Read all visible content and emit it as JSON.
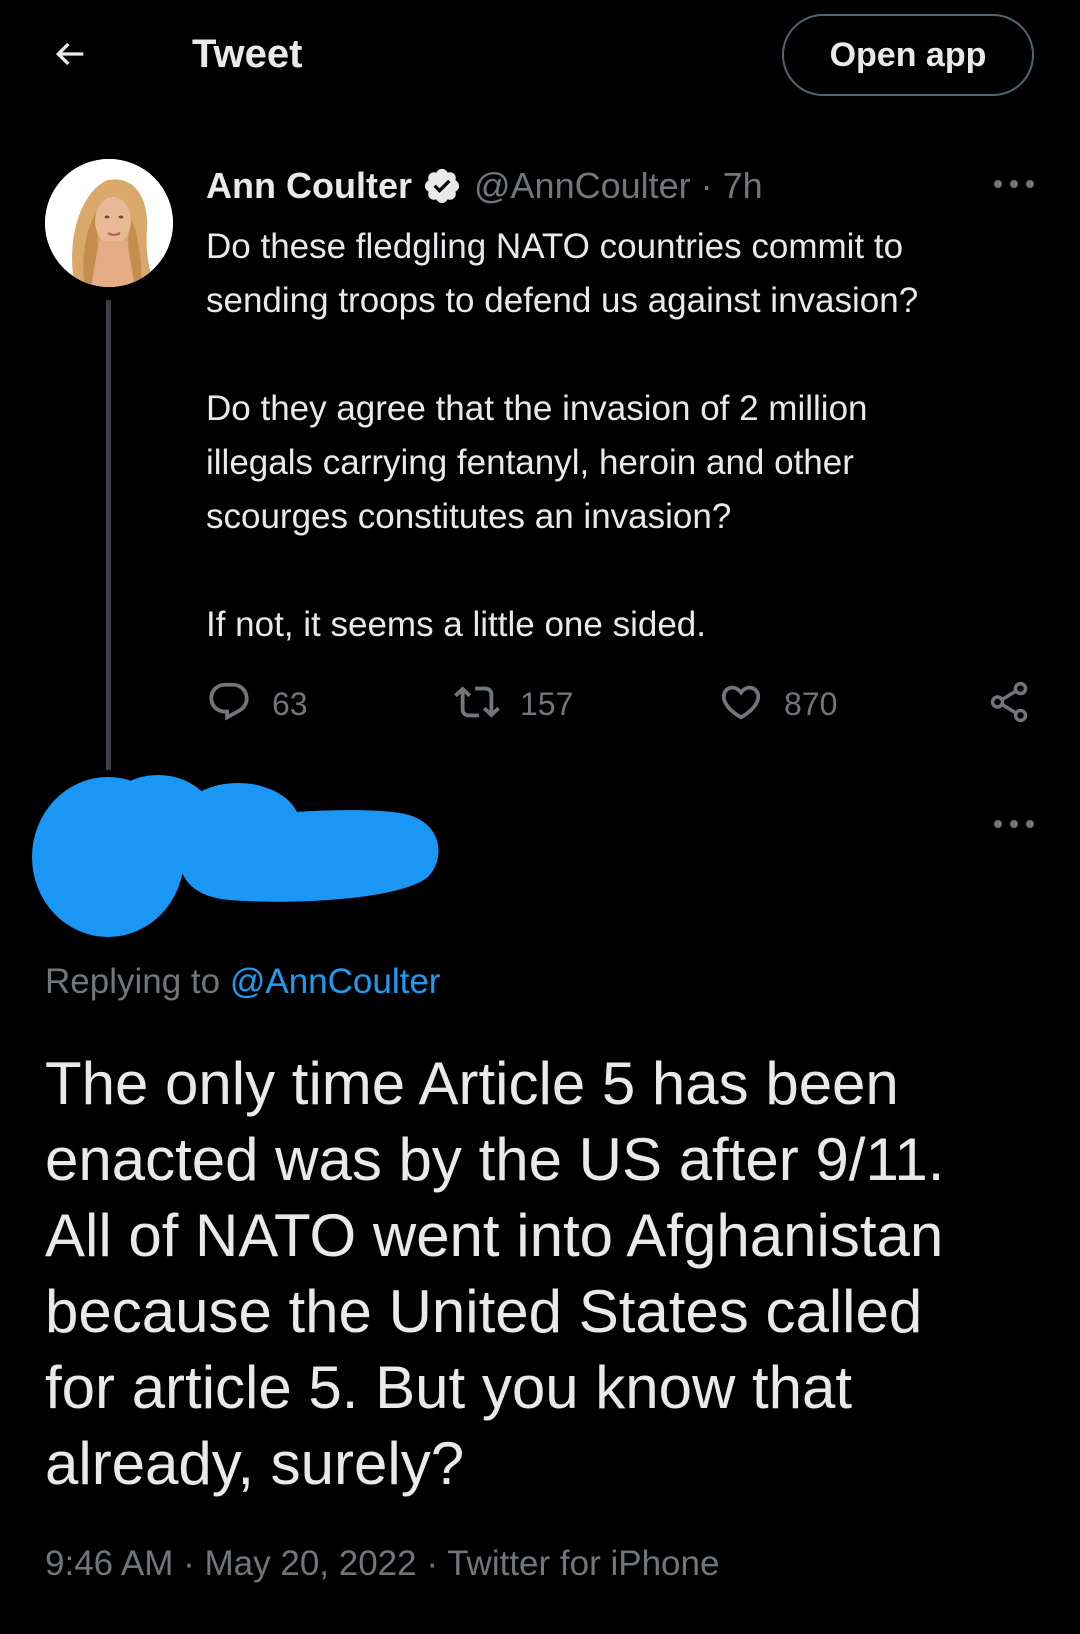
{
  "topbar": {
    "back_icon": "arrow-left-icon",
    "title": "Tweet",
    "open_app_label": "Open app"
  },
  "original_tweet": {
    "author_name": "Ann Coulter",
    "verified_icon": "verified-badge-icon",
    "handle_time": "@AnnCoulter · 7h",
    "more_icon": "more-horizontal-icon",
    "paragraphs": [
      "Do these fledgling NATO countries commit to\nsending troops to defend us against invasion?",
      "Do they agree that the invasion of 2 million\nillegals carrying fentanyl, heroin and other\nscourges constitutes an invasion?",
      "If not, it seems a little one sided."
    ],
    "actions": {
      "reply_icon": "comment-icon",
      "reply_count": "63",
      "retweet_icon": "retweet-icon",
      "retweet_count": "157",
      "like_icon": "heart-icon",
      "like_count": "870",
      "share_icon": "share-icon"
    }
  },
  "reply_tweet": {
    "author_redacted": true,
    "redaction_color": "#1a96f5",
    "more_icon": "more-horizontal-icon",
    "replying_prefix": "Replying to ",
    "replying_handle": "@AnnCoulter",
    "text": "The only time Article 5 has been\nenacted was by the US after 9/11.\nAll of NATO went into Afghanistan\nbecause the United States called\nfor article 5. But you know that\nalready, surely?",
    "time": "9:46 AM",
    "separator": " · ",
    "date": "May 20, 2022",
    "source": "Twitter for iPhone"
  },
  "colors": {
    "background": "#000000",
    "text_primary": "#e7e9ea",
    "text_secondary": "#71767b",
    "link": "#1d9bf0",
    "thread_line": "#3a4047"
  }
}
